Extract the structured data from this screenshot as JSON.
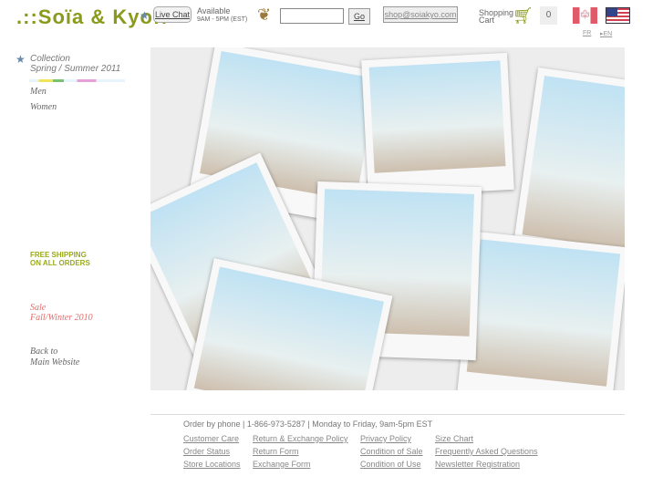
{
  "header": {
    "logo": ".::Soïa & Kyo::",
    "live_chat": "Live Chat",
    "available": "Available",
    "hours": "9AM - 5PM (EST)",
    "search_placeholder": "",
    "go": "Go",
    "email": "shop@soiakyo.com",
    "cart_label_1": "Shopping",
    "cart_label_2": "Cart",
    "cart_count": "0",
    "lang_fr": "FR",
    "lang_en": "EN"
  },
  "sidebar": {
    "collection": "Collection",
    "season": "Spring / Summer 2011",
    "men": "Men",
    "women": "Women",
    "promo_1": "FREE SHIPPING",
    "promo_2": "ON ALL ORDERS",
    "sale_1": "Sale",
    "sale_2": "Fall/Winter 2010",
    "back_1": "Back to",
    "back_2": "Main Website"
  },
  "colors": {
    "accent": "#8a9a1a",
    "promo": "#9aaa1a",
    "sale": "#e07070"
  },
  "footer": {
    "phone": "Order by phone | 1-866-973-5287 | Monday to Friday, 9am-5pm EST",
    "columns": [
      [
        "Customer Care",
        "Order Status",
        "Store Locations"
      ],
      [
        "Return & Exchange Policy",
        "Return Form",
        "Exchange Form"
      ],
      [
        "Privacy Policy",
        "Condition of Sale",
        "Condition of Use"
      ],
      [
        "Size Chart",
        "Frequently Asked Questions",
        "Newsletter Registration"
      ]
    ]
  }
}
